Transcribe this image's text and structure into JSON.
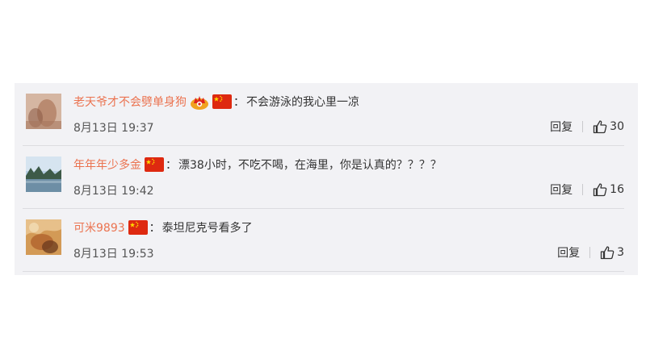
{
  "comments": [
    {
      "username": "老天爷才不会劈单身狗",
      "text": "不会游泳的我心里一凉",
      "time": "8月13日 19:37",
      "reply_label": "回复",
      "likes": "30",
      "has_crown": true,
      "avatar_colors": [
        "#c9a48c",
        "#8a5a45"
      ]
    },
    {
      "username": "年年年少多金",
      "text": "漂38小时，不吃不喝，在海里，你是认真的？？？？",
      "time": "8月13日 19:42",
      "reply_label": "回复",
      "likes": "16",
      "has_crown": false,
      "avatar_colors": [
        "#a9c4dc",
        "#3d5a48"
      ]
    },
    {
      "username": "可米9893",
      "text": "泰坦尼克号看多了",
      "time": "8月13日 19:53",
      "reply_label": "回复",
      "likes": "3",
      "has_crown": false,
      "avatar_colors": [
        "#d39a56",
        "#6b3a1e"
      ]
    }
  ],
  "colors": {
    "username": "#eb7350",
    "text": "#333333",
    "panel_bg": "#f2f2f5"
  },
  "icons": {
    "flag": "china-flag-icon",
    "crown": "crown-badge-icon",
    "like": "thumbs-up-icon"
  }
}
